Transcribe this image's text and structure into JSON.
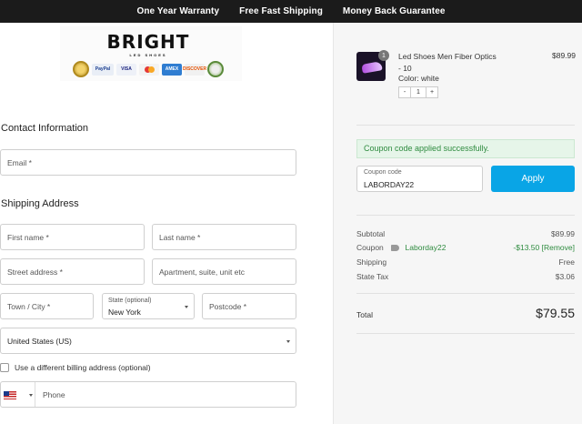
{
  "topbar": {
    "items": [
      "One Year Warranty",
      "Free Fast Shipping",
      "Money Back Guarantee"
    ]
  },
  "logo": {
    "brand": "BRIGHT",
    "sub": "LED SHOES",
    "payment_icons": [
      "trust-seal",
      "paypal",
      "visa",
      "mastercard",
      "amex",
      "discover",
      "secure-seal"
    ],
    "paypal_text": "PayPal",
    "visa_text": "VISA",
    "amex_text": "AMEX",
    "discover_text": "DISCOVER"
  },
  "contact": {
    "title": "Contact Information",
    "email_placeholder": "Email *"
  },
  "shipping": {
    "title": "Shipping Address",
    "first_name": "First name *",
    "last_name": "Last name *",
    "street": "Street address *",
    "apartment": "Apartment, suite, unit etc",
    "town": "Town / City *",
    "state_label": "State (optional)",
    "state_value": "New York",
    "postcode": "Postcode *",
    "country": "United States (US)",
    "billing_checkbox": "Use a different billing address (optional)",
    "phone_placeholder": "Phone"
  },
  "cart": {
    "item": {
      "name": "Led Shoes Men Fiber Optics - 10",
      "color": "Color:  white",
      "price": "$89.99",
      "qty_badge": "1",
      "qty": "1",
      "minus": "-",
      "plus": "+"
    },
    "coupon_success": "Coupon code applied successfully.",
    "coupon_label": "Coupon code",
    "coupon_value": "LABORDAY22",
    "apply_label": "Apply",
    "summary": {
      "subtotal_label": "Subtotal",
      "subtotal_value": "$89.99",
      "coupon_label": "Coupon",
      "coupon_code": "Laborday22",
      "coupon_value": "-$13.50",
      "coupon_remove": "[Remove]",
      "shipping_label": "Shipping",
      "shipping_value": "Free",
      "tax_label": "State Tax",
      "tax_value": "$3.06",
      "total_label": "Total",
      "total_value": "$79.55"
    }
  },
  "colors": {
    "topbar_bg": "#1b1b1b",
    "apply_btn": "#09a5e6",
    "success_text": "#2e8b3f"
  }
}
